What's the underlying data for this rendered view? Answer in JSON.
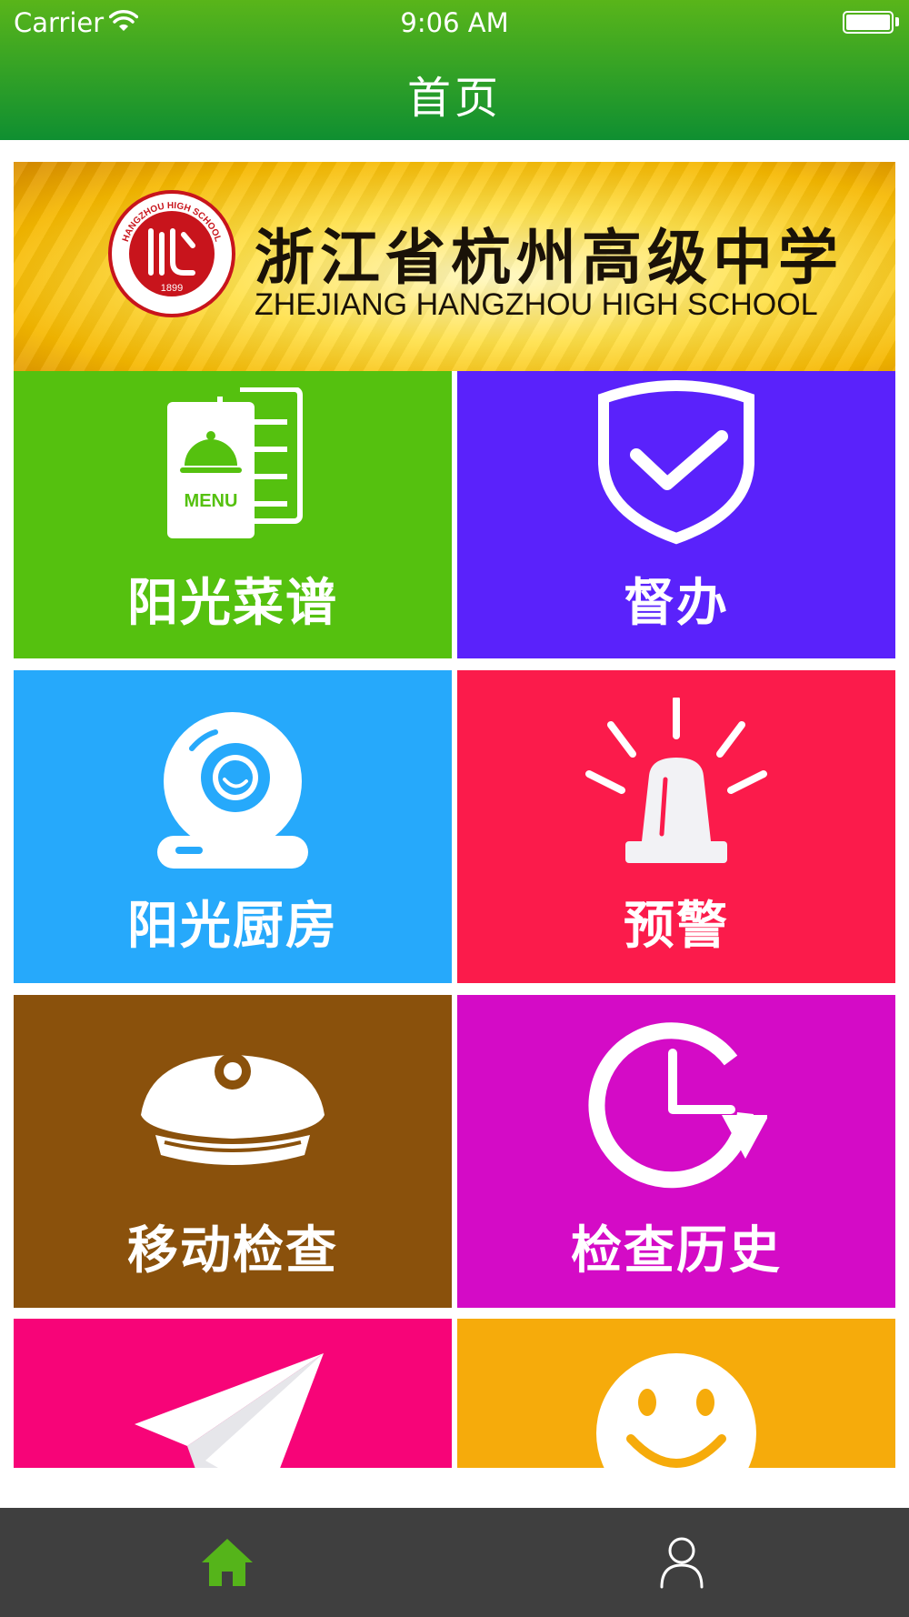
{
  "status_bar": {
    "carrier": "Carrier",
    "time": "9:06 AM"
  },
  "nav": {
    "title": "首页"
  },
  "banner": {
    "school_name_cn": "浙江省杭州高级中学",
    "school_name_en": "ZHEJIANG HANGZHOU HIGH SCHOOL",
    "logo_year": "1899",
    "logo_text": "HANGZHOU HIGH SCHOOL"
  },
  "tiles": [
    {
      "label": "阳光菜谱",
      "icon": "menu-icon",
      "color": "#55c10f",
      "menu_text": "MENU"
    },
    {
      "label": "督办",
      "icon": "shield-check-icon",
      "color": "#5a22fb"
    },
    {
      "label": "阳光厨房",
      "icon": "camera-icon",
      "color": "#26a9fb"
    },
    {
      "label": "预警",
      "icon": "alarm-icon",
      "color": "#fb1b4b"
    },
    {
      "label": "移动检查",
      "icon": "inspector-cap-icon",
      "color": "#8a510c"
    },
    {
      "label": "检查历史",
      "icon": "clock-history-icon",
      "color": "#d40bc6"
    },
    {
      "label": "",
      "icon": "paper-plane-icon",
      "color": "#f70478"
    },
    {
      "label": "",
      "icon": "smiley-icon",
      "color": "#f6ab0b"
    }
  ],
  "tab_bar": {
    "items": [
      {
        "name": "home",
        "icon": "home-icon",
        "active": true,
        "color": "#55b41a"
      },
      {
        "name": "profile",
        "icon": "person-icon",
        "active": false,
        "color": "#ffffff"
      }
    ]
  }
}
